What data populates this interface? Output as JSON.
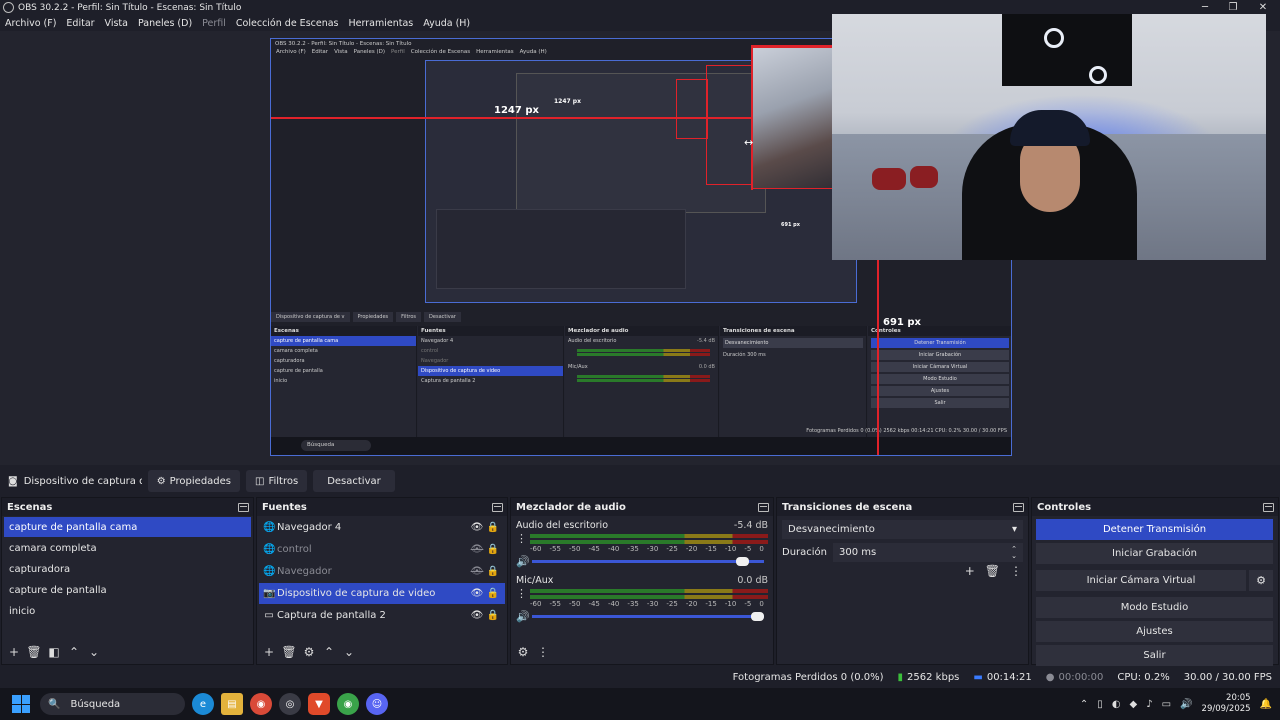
{
  "window": {
    "title": "OBS 30.2.2 - Perfil: Sin Título - Escenas: Sin Título",
    "controls": [
      "─",
      "❐",
      "✕"
    ]
  },
  "menu": [
    {
      "label": "Archivo (F)",
      "disabled": false
    },
    {
      "label": "Editar",
      "disabled": false
    },
    {
      "label": "Vista",
      "disabled": false
    },
    {
      "label": "Paneles (D)",
      "disabled": false
    },
    {
      "label": "Perfil",
      "disabled": true
    },
    {
      "label": "Colección de Escenas",
      "disabled": false
    },
    {
      "label": "Herramientas",
      "disabled": false
    },
    {
      "label": "Ayuda (H)",
      "disabled": false
    }
  ],
  "preview": {
    "measure_horizontal": "1247 px",
    "measure_vertical": "691 px",
    "nested": {
      "title": "OBS 30.2.2 - Perfil: Sin Título - Escenas: Sin Título",
      "menu": [
        "Archivo (F)",
        "Editar",
        "Vista",
        "Paneles (D)",
        "Perfil",
        "Colección de Escenas",
        "Herramientas",
        "Ayuda (H)"
      ],
      "inner_measure_h": "1247 px",
      "inner_measure_v": "691 px",
      "tabs": [
        "Dispositivo de captura de v",
        "Propiedades",
        "Filtros",
        "Desactivar"
      ],
      "panels": {
        "scenes_title": "Escenas",
        "sources_title": "Fuentes",
        "mixer_title": "Mezclador de audio",
        "transitions_title": "Transiciones de escena",
        "controls_title": "Controles"
      },
      "scenes": [
        "capture de pantalla cama",
        "camara completa",
        "capturadora",
        "capture de pantalla",
        "inicio"
      ],
      "sources": [
        "Navegador 4",
        "control",
        "Navegador",
        "Dispositivo de captura de video",
        "Captura de pantalla 2"
      ],
      "mixer": {
        "ch1": "Audio del escritorio",
        "ch1_db": "-5.4 dB",
        "ch2": "Mic/Aux",
        "ch2_db": "0.0 dB"
      },
      "transition": "Desvanecimiento",
      "duration_label": "Duración",
      "duration": "300 ms",
      "controls": [
        "Detener Transmisión",
        "Iniciar Grabación",
        "Iniciar Cámara Virtual",
        "Modo Estudio",
        "Ajustes",
        "Salir"
      ],
      "status": "Fotogramas Perdidos 0 (0.0%)   2562 kbps   00:14:21   CPU: 0.2%   30.00 / 30.00 FPS",
      "search": "Búsqueda"
    }
  },
  "source_toolbar": {
    "source_name": "Dispositivo de captura de v",
    "buttons": [
      {
        "icon": "⚙",
        "label": "Propiedades"
      },
      {
        "icon": "◫",
        "label": "Filtros"
      },
      {
        "icon": "",
        "label": "Desactivar"
      }
    ]
  },
  "scenes": {
    "title": "Escenas",
    "items": [
      {
        "label": "capture de pantalla cama",
        "selected": true
      },
      {
        "label": "camara completa",
        "selected": false
      },
      {
        "label": "capturadora",
        "selected": false
      },
      {
        "label": "capture de pantalla",
        "selected": false
      },
      {
        "label": "inicio",
        "selected": false
      }
    ],
    "footer": [
      "+",
      "🗑",
      "◧",
      "⌃",
      "⌄"
    ]
  },
  "sources": {
    "title": "Fuentes",
    "items": [
      {
        "icon": "🌐",
        "label": "Navegador 4",
        "visible": true,
        "dim": false,
        "selected": false
      },
      {
        "icon": "🌐",
        "label": "control",
        "visible": false,
        "dim": true,
        "selected": false
      },
      {
        "icon": "🌐",
        "label": "Navegador",
        "visible": false,
        "dim": true,
        "selected": false
      },
      {
        "icon": "📷",
        "label": "Dispositivo de captura de video",
        "visible": true,
        "dim": false,
        "selected": true
      },
      {
        "icon": "▭",
        "label": "Captura de pantalla 2",
        "visible": true,
        "dim": false,
        "selected": false
      }
    ],
    "footer": [
      "+",
      "🗑",
      "⚙",
      "⌃",
      "⌄"
    ]
  },
  "mixer": {
    "title": "Mezclador de audio",
    "scale": [
      "-60",
      "-55",
      "-50",
      "-45",
      "-40",
      "-35",
      "-30",
      "-25",
      "-20",
      "-15",
      "-10",
      "-5",
      "0"
    ],
    "channels": [
      {
        "name": "Audio del escritorio",
        "db": "-5.4 dB",
        "volume": 0.93
      },
      {
        "name": "Mic/Aux",
        "db": "0.0 dB",
        "volume": 1.0
      }
    ],
    "footer": [
      "⚙",
      "⋮"
    ]
  },
  "transitions": {
    "title": "Transiciones de escena",
    "selected": "Desvanecimiento",
    "duration_label": "Duración",
    "duration": "300 ms",
    "actions": [
      "+",
      "🗑",
      "⋮"
    ]
  },
  "controls": {
    "title": "Controles",
    "stop_stream": "Detener Transmisión",
    "start_record": "Iniciar Grabación",
    "start_virtualcam": "Iniciar Cámara Virtual",
    "studio_mode": "Modo Estudio",
    "settings": "Ajustes",
    "exit": "Salir"
  },
  "status": {
    "dropped_frames": "Fotogramas Perdidos 0 (0.0%)",
    "bitrate": "2562 kbps",
    "stream_time": "00:14:21",
    "record_time": "00:00:00",
    "cpu": "CPU: 0.2%",
    "fps": "30.00 / 30.00 FPS"
  },
  "taskbar": {
    "search_placeholder": "Búsqueda",
    "time": "20:05",
    "date": "29/09/2025"
  },
  "colors": {
    "accent": "#2f4ac4",
    "background": "#1e1f29",
    "panel": "#23242f",
    "measure_line": "#e0222a"
  }
}
